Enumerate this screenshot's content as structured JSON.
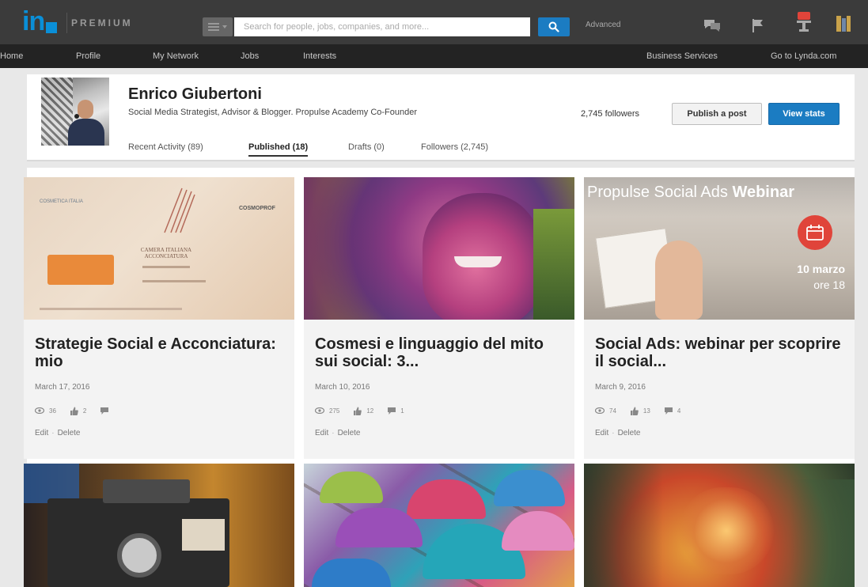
{
  "topbar": {
    "logo_text": "in",
    "premium_label": "PREMIUM",
    "search_placeholder": "Search for people, jobs, companies, and more...",
    "advanced_label": "Advanced",
    "icons": [
      "messages-icon",
      "flag-icon",
      "notifications-icon",
      "account-icon"
    ]
  },
  "nav": {
    "items": [
      "Home",
      "Profile",
      "My Network",
      "Jobs",
      "Interests"
    ],
    "right_items": [
      "Business Services",
      "Go to Lynda.com"
    ]
  },
  "profile": {
    "name": "Enrico Giubertoni",
    "headline": "Social Media Strategist, Advisor & Blogger. Propulse Academy Co-Founder",
    "followers": "2,745 followers",
    "publish_label": "Publish a post",
    "stats_label": "View stats",
    "tabs": [
      {
        "label": "Recent Activity (89)",
        "active": false
      },
      {
        "label": "Published (18)",
        "active": true
      },
      {
        "label": "Drafts (0)",
        "active": false
      },
      {
        "label": "Followers (2,745)",
        "active": false
      }
    ]
  },
  "posts": [
    {
      "title": "Strategie Social e Acconciatura: mio",
      "date": "March 17, 2016",
      "views": "36",
      "likes": "2",
      "comments": "",
      "edit": "Edit",
      "delete": "Delete",
      "image_text": [
        "COSMETICA ITALIA",
        "CAMERA ITALIANA ACCONCIATURA",
        "COSMOPROF"
      ]
    },
    {
      "title": "Cosmesi e linguaggio del mito sui social: 3...",
      "date": "March 10, 2016",
      "views": "275",
      "likes": "12",
      "comments": "1",
      "edit": "Edit",
      "delete": "Delete"
    },
    {
      "title": "Social Ads: webinar per scoprire il social...",
      "date": "March 9, 2016",
      "views": "74",
      "likes": "13",
      "comments": "4",
      "edit": "Edit",
      "delete": "Delete",
      "image_text": {
        "prefix": "Propulse Social Ads ",
        "emph": "Webinar",
        "date": "10 marzo",
        "time": "ore 18"
      }
    }
  ],
  "colors": {
    "linkedin_blue": "#0a8fd8",
    "button_blue": "#1b7cc2",
    "topbar_bg": "#3b3b3b",
    "nav_bg": "#232323",
    "badge_red": "#e0443a"
  }
}
